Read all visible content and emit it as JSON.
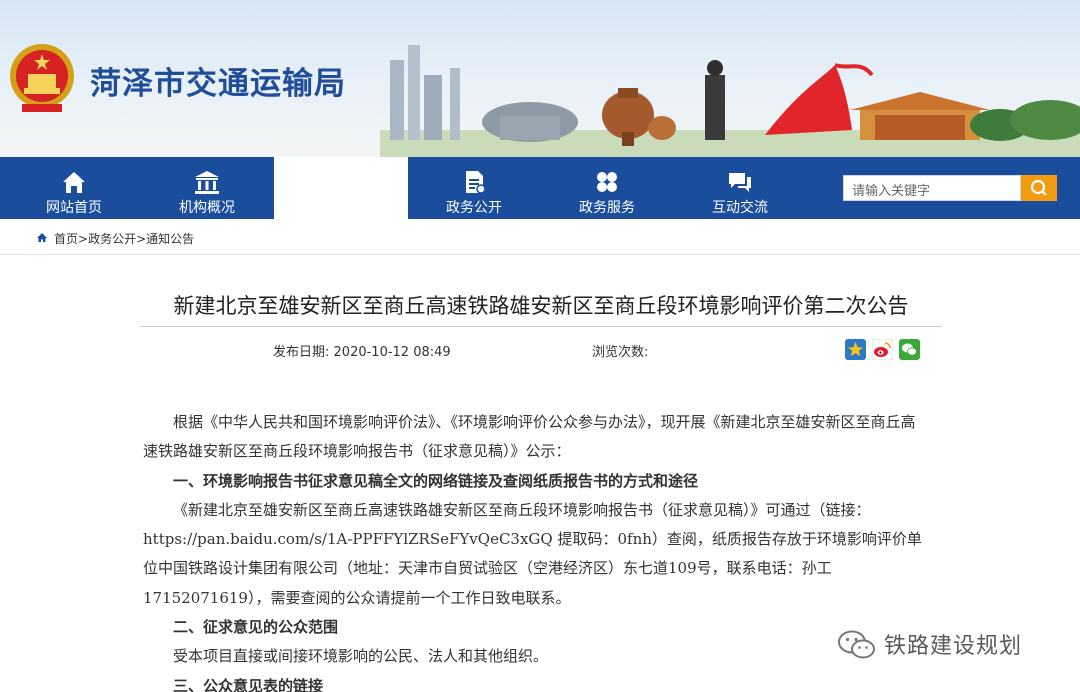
{
  "header": {
    "site_title": "菏泽市交通运输局"
  },
  "nav": {
    "items": [
      {
        "label": "网站首页",
        "icon": "home-icon"
      },
      {
        "label": "机构概况",
        "icon": "institution-icon"
      },
      {
        "label": "政务公开",
        "icon": "document-icon"
      },
      {
        "label": "政务服务",
        "icon": "service-icon"
      },
      {
        "label": "互动交流",
        "icon": "chat-icon"
      }
    ],
    "search": {
      "placeholder": "请输入关键字"
    }
  },
  "breadcrumb": {
    "home": "首页",
    "level1": "政务公开",
    "level2": "通知公告",
    "sep": ">"
  },
  "article": {
    "title": "新建北京至雄安新区至商丘高速铁路雄安新区至商丘段环境影响评价第二次公告",
    "publish_label": "发布日期:",
    "publish_date": "2020-10-12 08:49",
    "views_label": "浏览次数:",
    "paragraphs": [
      {
        "text": "根据《中华人民共和国环境影响评价法》、《环境影响评价公众参与办法》，现开展《新建北京至雄安新区至商丘高速铁路雄安新区至商丘段环境影响报告书（征求意见稿）》公示：",
        "heading": false
      },
      {
        "text": "一、环境影响报告书征求意见稿全文的网络链接及查阅纸质报告书的方式和途径",
        "heading": true
      },
      {
        "text": "《新建北京至雄安新区至商丘高速铁路雄安新区至商丘段环境影响报告书（征求意见稿）》可通过（链接：https://pan.baidu.com/s/1A-PPFFYlZRSeFYvQeC3xGQ 提取码：0fnh）查阅，纸质报告存放于环境影响评价单位中国铁路设计集团有限公司（地址：天津市自贸试验区（空港经济区）东七道109号，联系电话：孙工17152071619），需要查阅的公众请提前一个工作日致电联系。",
        "heading": false
      },
      {
        "text": "二、征求意见的公众范围",
        "heading": true
      },
      {
        "text": "受本项目直接或间接环境影响的公民、法人和其他组织。",
        "heading": false
      },
      {
        "text": "三、公众意见表的链接",
        "heading": true
      }
    ]
  },
  "share": [
    {
      "icon": "qzone-star-icon"
    },
    {
      "icon": "weibo-icon"
    },
    {
      "icon": "wechat-icon"
    }
  ],
  "watermark": {
    "text": "铁路建设规划",
    "icon": "wechat-logo-icon"
  },
  "colors": {
    "nav": "#1a4d9c",
    "title": "#1f4d99",
    "search_button": "#f39c12"
  }
}
